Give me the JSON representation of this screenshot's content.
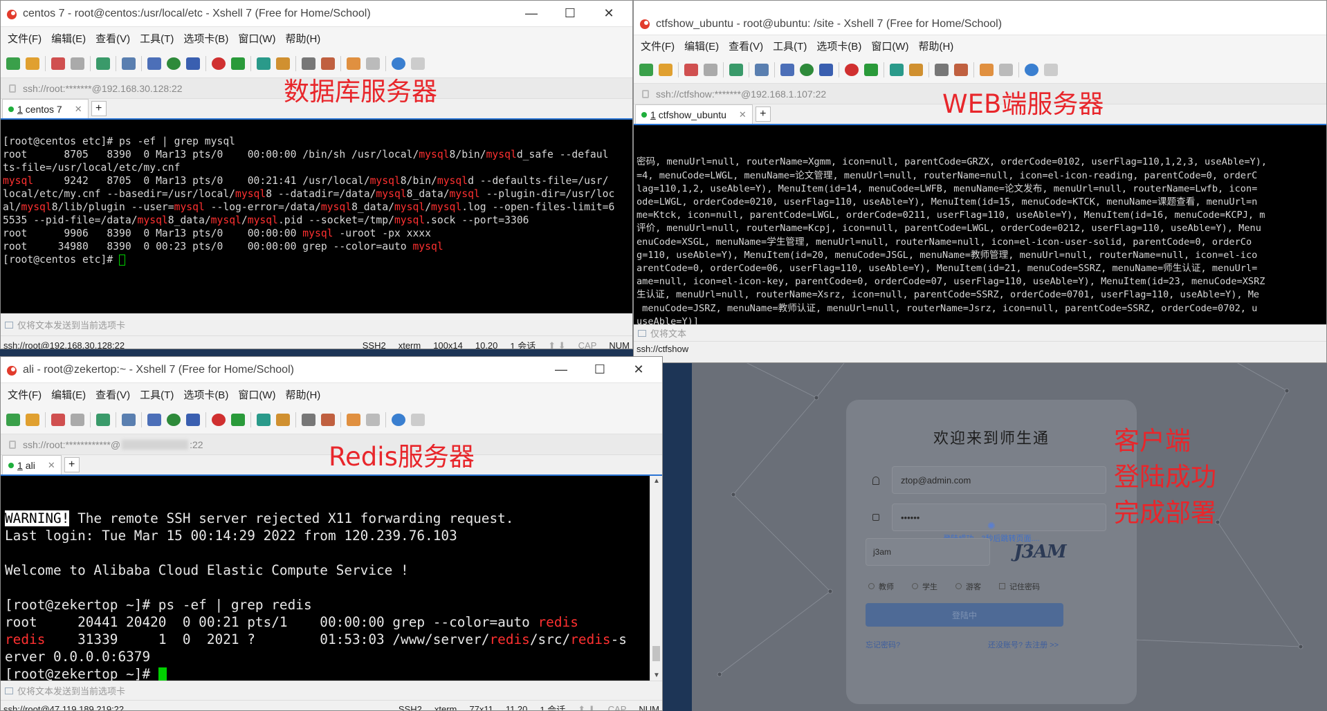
{
  "menus": [
    "文件(F)",
    "编辑(E)",
    "查看(V)",
    "工具(T)",
    "选项卡(B)",
    "窗口(W)",
    "帮助(H)"
  ],
  "send_hint": "仅将文本发送到当前选项卡",
  "db": {
    "title": "centos 7 - root@centos:/usr/local/etc - Xshell 7 (Free for Home/School)",
    "address": "ssh://root:*******@192.168.30.128:22",
    "tab_num": "1",
    "tab_label": "centos 7",
    "annotation": "数据库服务器",
    "status": {
      "conn": "ssh://root@192.168.30.128:22",
      "proto": "SSH2",
      "term": "xterm",
      "size": "100x14",
      "pos": "10,20",
      "sessions": "1 会话",
      "cap": "CAP",
      "num": "NUM"
    }
  },
  "web": {
    "title": "ctfshow_ubuntu - root@ubuntu: /site - Xshell 7 (Free for Home/School)",
    "address": "ssh://ctfshow:*******@192.168.1.107:22",
    "tab_num": "1",
    "tab_label": "ctfshow_ubuntu",
    "annotation": "WEB端服务器",
    "terminal_lines": [
      "密码, menuUrl=null, routerName=Xgmm, icon=null, parentCode=GRZX, orderCode=0102, userFlag=110,1,2,3, useAble=Y),",
      "=4, menuCode=LWGL, menuName=论文管理, menuUrl=null, routerName=null, icon=el-icon-reading, parentCode=0, orderC",
      "lag=110,1,2, useAble=Y), MenuItem(id=14, menuCode=LWFB, menuName=论文发布, menuUrl=null, routerName=Lwfb, icon=",
      "ode=LWGL, orderCode=0210, userFlag=110, useAble=Y), MenuItem(id=15, menuCode=KTCK, menuName=课题查看, menuUrl=n",
      "me=Ktck, icon=null, parentCode=LWGL, orderCode=0211, userFlag=110, useAble=Y), MenuItem(id=16, menuCode=KCPJ, m",
      "评价, menuUrl=null, routerName=Kcpj, icon=null, parentCode=LWGL, orderCode=0212, userFlag=110, useAble=Y), Menu",
      "enuCode=XSGL, menuName=学生管理, menuUrl=null, routerName=null, icon=el-icon-user-solid, parentCode=0, orderCo",
      "g=110, useAble=Y), MenuItem(id=20, menuCode=JSGL, menuName=教师管理, menuUrl=null, routerName=null, icon=el-ico",
      "arentCode=0, orderCode=06, userFlag=110, useAble=Y), MenuItem(id=21, menuCode=SSRZ, menuName=师生认证, menuUrl=",
      "ame=null, icon=el-icon-key, parentCode=0, orderCode=07, userFlag=110, useAble=Y), MenuItem(id=23, menuCode=XSRZ",
      "生认证, menuUrl=null, routerName=Xsrz, icon=null, parentCode=SSRZ, orderCode=0701, userFlag=110, useAble=Y), Me",
      " menuCode=JSRZ, menuName=教师认证, menuUrl=null, routerName=Jsrz, icon=null, parentCode=SSRZ, orderCode=0702, u",
      "useAble=Y)]"
    ],
    "send_hint_partial": "仅将文本",
    "status_partial": "ssh://ctfshow"
  },
  "redis": {
    "title": "ali - root@zekertop:~ - Xshell 7 (Free for Home/School)",
    "address_prefix": "ssh://root:************@",
    "address_suffix": ":22",
    "tab_num": "1",
    "tab_label": "ali",
    "annotation": "Redis服务器",
    "status": {
      "conn": "ssh://root@47.119.189.219:22",
      "proto": "SSH2",
      "term": "xterm",
      "size": "77x11",
      "pos": "11,20",
      "sessions": "1 会话",
      "cap": "CAP",
      "num": "NUM"
    }
  },
  "client": {
    "heading": "欢迎来到师生通",
    "username": "ztop@admin.com",
    "password_mask": "••••••",
    "captcha_value": "j3am",
    "captcha_image": "J3AM",
    "toast": "登陆成功，3秒后跳转页面....",
    "roles": [
      "教师",
      "学生",
      "游客"
    ],
    "remember": "记住密码",
    "login_button": "登陆中",
    "forgot": "忘记密码?",
    "register": "还没账号? 去注册 >>",
    "annotation_lines": [
      "客户端",
      "登陆成功",
      "完成部署"
    ]
  }
}
